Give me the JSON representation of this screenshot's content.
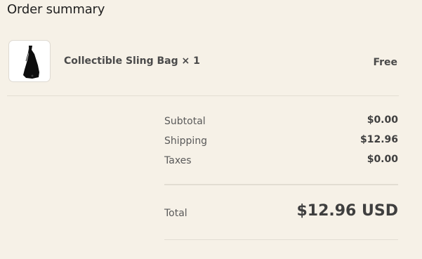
{
  "order_summary": {
    "title": "Order summary",
    "item": {
      "name": "Collectible Sling Bag × 1",
      "price": "Free",
      "image_icon": "sling-bag-thumbnail"
    },
    "lines": [
      {
        "label": "Subtotal",
        "value": "$0.00"
      },
      {
        "label": "Shipping",
        "value": "$12.96"
      },
      {
        "label": "Taxes",
        "value": "$0.00"
      }
    ],
    "total": {
      "label": "Total",
      "value": "$12.96 USD"
    }
  },
  "colors": {
    "background": "#f6f1e7",
    "divider": "#e2ddd2",
    "text": "#3f3f3f"
  }
}
